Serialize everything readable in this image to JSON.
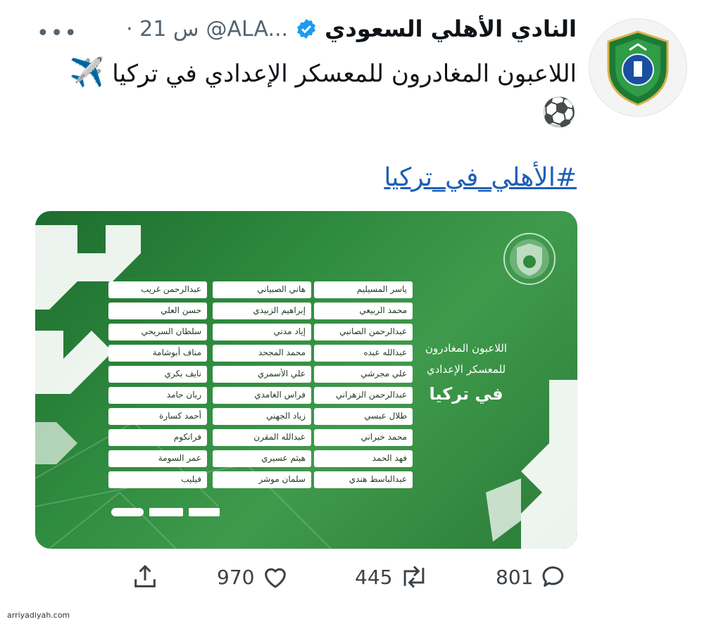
{
  "tweet": {
    "display_name": "النادي الأهلي السعودي",
    "handle": "@ALA...",
    "time": "· 21 س",
    "text": "اللاعبون المغادرون للمعسكر الإعدادي في تركيا",
    "hashtag": "#الأهلي_في_تركيا"
  },
  "media": {
    "title_line1": "اللاعبون المغادرون",
    "title_line2": "للمعسكر الإعدادي",
    "title_line3": "في تركيا",
    "columns": [
      [
        "ياسر المسيليم",
        "محمد الربيعي",
        "عبدالرحمن الصانبي",
        "عبدالله عبده",
        "علي مجرشي",
        "عبدالرحمن الزهراني",
        "طلال عبسي",
        "محمد خبراني",
        "فهد الحمد",
        "عبدالباسط هندي"
      ],
      [
        "هاني الصبياني",
        "إبراهيم الزبيدي",
        "إياد مدني",
        "محمد المجحد",
        "علي الأسمري",
        "فراس الغامدي",
        "زياد الجهني",
        "عبدالله المقرن",
        "هيثم عسيري",
        "سلمان موشر"
      ],
      [
        "عبدالرحمن غريب",
        "حسن العلي",
        "سلطان السريحي",
        "مناف أبوشامة",
        "نايف بكري",
        "ريان حامد",
        "أحمد كسارة",
        "فرانكوم",
        "عمر السومة",
        "فيليب"
      ]
    ]
  },
  "actions": {
    "replies": "801",
    "retweets": "445",
    "likes": "970"
  },
  "watermark": "arriyadiyah.com",
  "colors": {
    "media_green": "#2e8a3e",
    "hashtag_blue": "#1d5fb8",
    "verified_blue": "#1d9bf0"
  },
  "icons": [
    "verified-icon",
    "more-icon",
    "airplane-icon",
    "soccer-ball-icon",
    "reply-icon",
    "retweet-icon",
    "like-icon",
    "share-icon"
  ]
}
